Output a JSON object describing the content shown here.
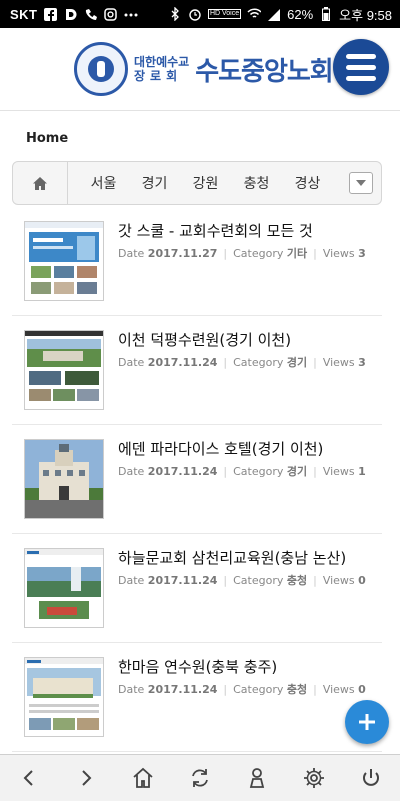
{
  "status_bar": {
    "carrier": "SKT",
    "battery": "62%",
    "time": "오후 9:58",
    "hd_label": "HD Voice"
  },
  "header": {
    "logo_sub_top": "대한예수교",
    "logo_sub_bottom": "장로회",
    "logo_main": "수도중앙노회",
    "menu_icon": "hamburger-icon",
    "brand_color": "#1b4a96"
  },
  "breadcrumb": "Home",
  "categories": [
    "서울",
    "경기",
    "강원",
    "충청",
    "경상"
  ],
  "meta_labels": {
    "date": "Date",
    "category": "Category",
    "views": "Views"
  },
  "posts": [
    {
      "title": "갓 스쿨 - 교회수련회의 모든 것",
      "date": "2017.11.27",
      "category": "기타",
      "views": "3"
    },
    {
      "title": "이천 덕평수련원(경기 이천)",
      "date": "2017.11.24",
      "category": "경기",
      "views": "3"
    },
    {
      "title": "에덴 파라다이스 호텔(경기 이천)",
      "date": "2017.11.24",
      "category": "경기",
      "views": "1"
    },
    {
      "title": "하늘문교회 삼천리교육원(충남 논산)",
      "date": "2017.11.24",
      "category": "충청",
      "views": "0"
    },
    {
      "title": "한마음 연수원(충북 충주)",
      "date": "2017.11.24",
      "category": "충청",
      "views": "0"
    }
  ],
  "bottom_nav": [
    "back-icon",
    "forward-icon",
    "home-icon",
    "refresh-icon",
    "user-icon",
    "settings-icon",
    "power-icon"
  ],
  "fab_icon": "plus-icon"
}
